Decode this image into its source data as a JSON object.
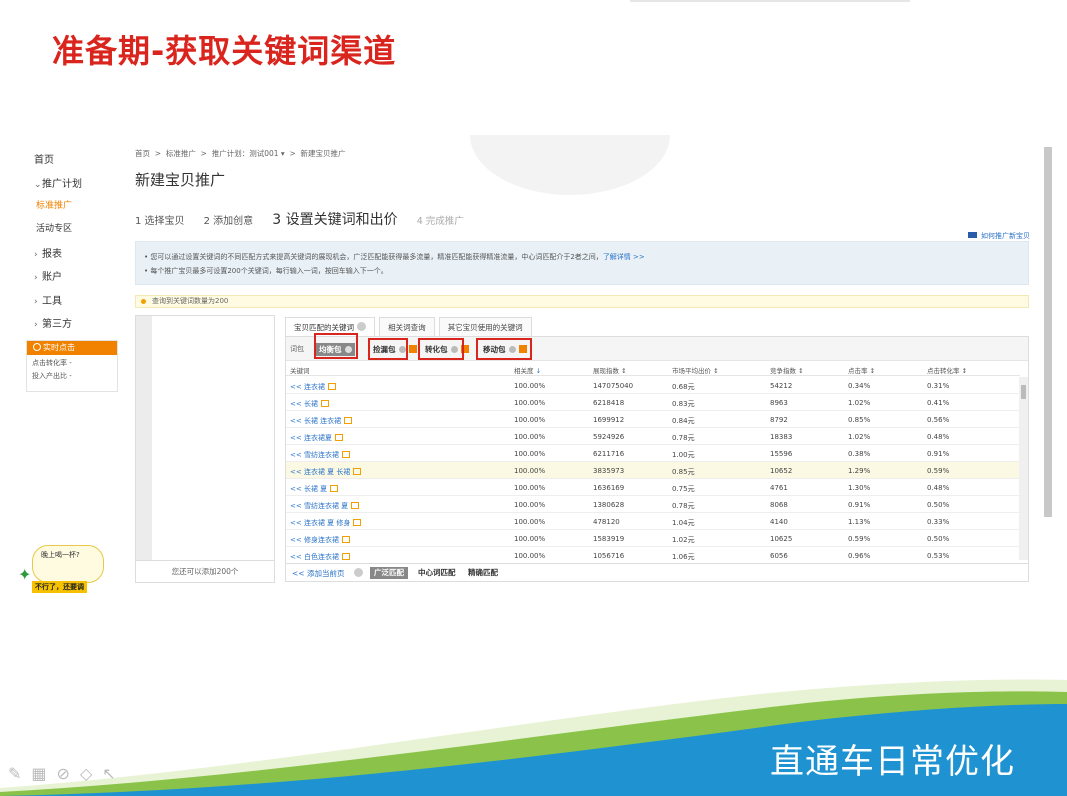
{
  "slide": {
    "title": "准备期-获取关键词渠道",
    "footer": "直通车日常优化"
  },
  "nav": {
    "items": [
      {
        "label": "首页",
        "arrow": ""
      },
      {
        "label": "推广计划",
        "arrow": "v"
      },
      {
        "label": "标准推广",
        "arrow": "",
        "active": true
      },
      {
        "label": "活动专区",
        "arrow": ""
      },
      {
        "label": "报表",
        "arrow": ">"
      },
      {
        "label": "账户",
        "arrow": ">"
      },
      {
        "label": "工具",
        "arrow": ">"
      },
      {
        "label": "第三方",
        "arrow": ">"
      }
    ],
    "realtime": {
      "title": "实时点击",
      "rows": [
        "点击转化率 -",
        "投入产出比 -"
      ]
    }
  },
  "breadcrumb": {
    "items": [
      "首页",
      "标准推广",
      "推广计划：测试001 ▾",
      "新建宝贝推广"
    ],
    "sep": ">"
  },
  "page": {
    "title": "新建宝贝推广",
    "howto": "如何推广新宝贝"
  },
  "steps": [
    "1 选择宝贝",
    "2 添加创意",
    "3 设置关键词和出价",
    "4 完成推广"
  ],
  "info": {
    "line1": "• 您可以通过设置关键词的不同匹配方式来提高关键词的展现机会，广泛匹配能获得最多流量，精准匹配能获得精准流量，中心词匹配介于2者之间，",
    "line1_link": "了解详情 >>",
    "line2": "• 每个推广宝贝最多可设置200个关键词，每行输入一词，按回车输入下一个。"
  },
  "warning": "查询到关键词数量为200",
  "leftpane": {
    "footer": "您还可以添加200个"
  },
  "tabs": [
    "宝贝匹配的关键词",
    "相关词查询",
    "其它宝贝使用的关键词"
  ],
  "packages": {
    "label": "词包",
    "items": [
      "均衡包",
      "捡漏包",
      "转化包",
      "移动包"
    ]
  },
  "table": {
    "headers": [
      "关键词",
      "相关度",
      "展现指数",
      "市场平均出价",
      "竞争指数",
      "点击率",
      "点击转化率"
    ],
    "rows": [
      {
        "kw": "<< 连衣裙",
        "rel": "100.00%",
        "imp": "147075040",
        "bid": "0.68元",
        "comp": "54212",
        "ctr": "0.34%",
        "cvr": "0.31%"
      },
      {
        "kw": "<< 长裙",
        "rel": "100.00%",
        "imp": "6218418",
        "bid": "0.83元",
        "comp": "8963",
        "ctr": "1.02%",
        "cvr": "0.41%"
      },
      {
        "kw": "<< 长裙 连衣裙",
        "rel": "100.00%",
        "imp": "1699912",
        "bid": "0.84元",
        "comp": "8792",
        "ctr": "0.85%",
        "cvr": "0.56%"
      },
      {
        "kw": "<< 连衣裙夏",
        "rel": "100.00%",
        "imp": "5924926",
        "bid": "0.78元",
        "comp": "18383",
        "ctr": "1.02%",
        "cvr": "0.48%"
      },
      {
        "kw": "<< 雪纺连衣裙",
        "rel": "100.00%",
        "imp": "6211716",
        "bid": "1.00元",
        "comp": "15596",
        "ctr": "0.38%",
        "cvr": "0.91%"
      },
      {
        "kw": "<< 连衣裙 夏 长裙",
        "rel": "100.00%",
        "imp": "3835973",
        "bid": "0.85元",
        "comp": "10652",
        "ctr": "1.29%",
        "cvr": "0.59%"
      },
      {
        "kw": "<< 长裙 夏",
        "rel": "100.00%",
        "imp": "1636169",
        "bid": "0.75元",
        "comp": "4761",
        "ctr": "1.30%",
        "cvr": "0.48%"
      },
      {
        "kw": "<< 雪纺连衣裙 夏",
        "rel": "100.00%",
        "imp": "1380628",
        "bid": "0.78元",
        "comp": "8068",
        "ctr": "0.91%",
        "cvr": "0.50%"
      },
      {
        "kw": "<< 连衣裙 夏 修身",
        "rel": "100.00%",
        "imp": "478120",
        "bid": "1.04元",
        "comp": "4140",
        "ctr": "1.13%",
        "cvr": "0.33%"
      },
      {
        "kw": "<< 修身连衣裙",
        "rel": "100.00%",
        "imp": "1583919",
        "bid": "1.02元",
        "comp": "10625",
        "ctr": "0.59%",
        "cvr": "0.50%"
      },
      {
        "kw": "<< 白色连衣裙",
        "rel": "100.00%",
        "imp": "1056716",
        "bid": "1.06元",
        "comp": "6056",
        "ctr": "0.96%",
        "cvr": "0.53%"
      }
    ]
  },
  "bottombar": {
    "add_page": "<< 添加当前页",
    "matches": [
      "广泛匹配",
      "中心词匹配",
      "精确匹配"
    ]
  },
  "mascot": {
    "bubble": "晚上喝一杯?",
    "reply": "不行了，还要调"
  },
  "colors": {
    "title_red": "#d9251d",
    "accent_orange": "#f08200",
    "link_blue": "#2a72c8",
    "footer_blue": "#1f93d1"
  }
}
